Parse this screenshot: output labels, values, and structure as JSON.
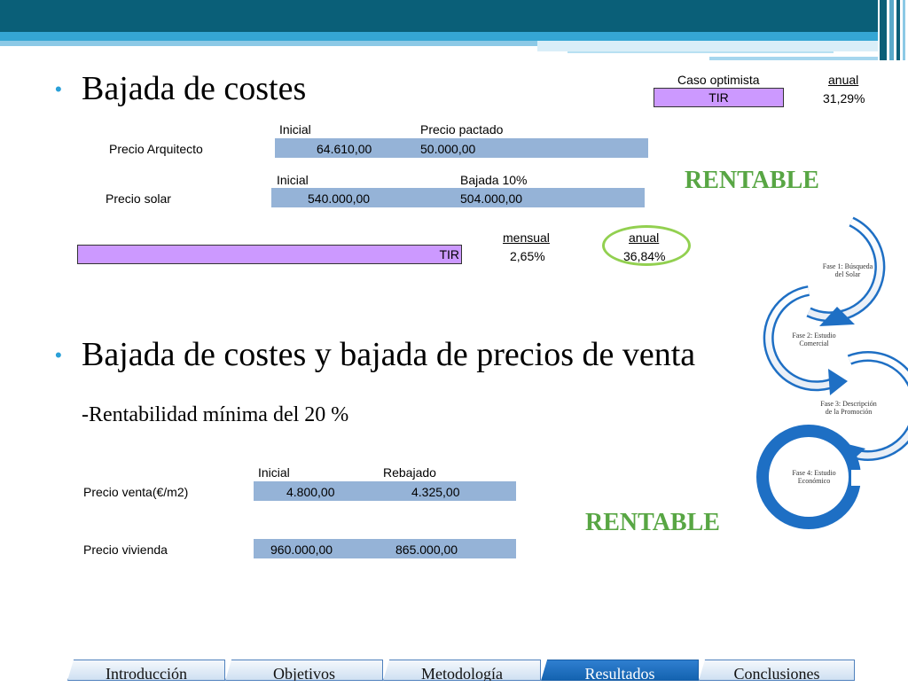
{
  "section1": {
    "bullet": "Bajada de costes",
    "caso_label": "Caso optimista",
    "anual_label": "anual",
    "tir_label": "TIR",
    "tir_value": "31,29%",
    "arq": {
      "col1": "Inicial",
      "col2": "Precio pactado",
      "row_label": "Precio Arquitecto",
      "v1": "64.610,00",
      "v2": "50.000,00"
    },
    "solar": {
      "col1": "Inicial",
      "col2": "Bajada 10%",
      "row_label": "Precio solar",
      "v1": "540.000,00",
      "v2": "504.000,00"
    },
    "rentable": "RENTABLE",
    "tir2": {
      "label": "TIR",
      "mensual_label": "mensual",
      "anual_label": "anual",
      "mensual": "2,65%",
      "anual": "36,84%"
    }
  },
  "section2": {
    "bullet": "Bajada de costes y bajada de precios de venta",
    "subtitle": "-Rentabilidad mínima del 20 %",
    "col1": "Inicial",
    "col2": "Rebajado",
    "rows": [
      {
        "label": "Precio venta(€/m2)",
        "v1": "4.800,00",
        "v2": "4.325,00"
      },
      {
        "label": "Precio vivienda",
        "v1": "960.000,00",
        "v2": "865.000,00"
      }
    ],
    "rentable": "RENTABLE"
  },
  "phases": [
    {
      "line1": "Fase 1: Búsqueda",
      "line2": "del  Solar"
    },
    {
      "line1": "Fase 2: Estudio",
      "line2": "Comercial"
    },
    {
      "line1": "Fase 3: Descripción",
      "line2": "de la     Promoción"
    },
    {
      "line1": "Fase 4: Estudio",
      "line2": "Económico"
    }
  ],
  "tabs": [
    {
      "label": "Introducción",
      "active": false
    },
    {
      "label": "Objetivos",
      "active": false
    },
    {
      "label": "Metodología",
      "active": false
    },
    {
      "label": "Resultados",
      "active": true
    },
    {
      "label": "Conclusiones",
      "active": false
    }
  ],
  "colors": {
    "header": "#0a5f78",
    "accent": "#35a6d4",
    "band": "#95b3d7",
    "purple": "#cc99ff",
    "rentable": "#58a644",
    "phase_ring": "#1e6fc4",
    "phase_active": "#1e6fc4",
    "ellipse": "#92d050"
  }
}
